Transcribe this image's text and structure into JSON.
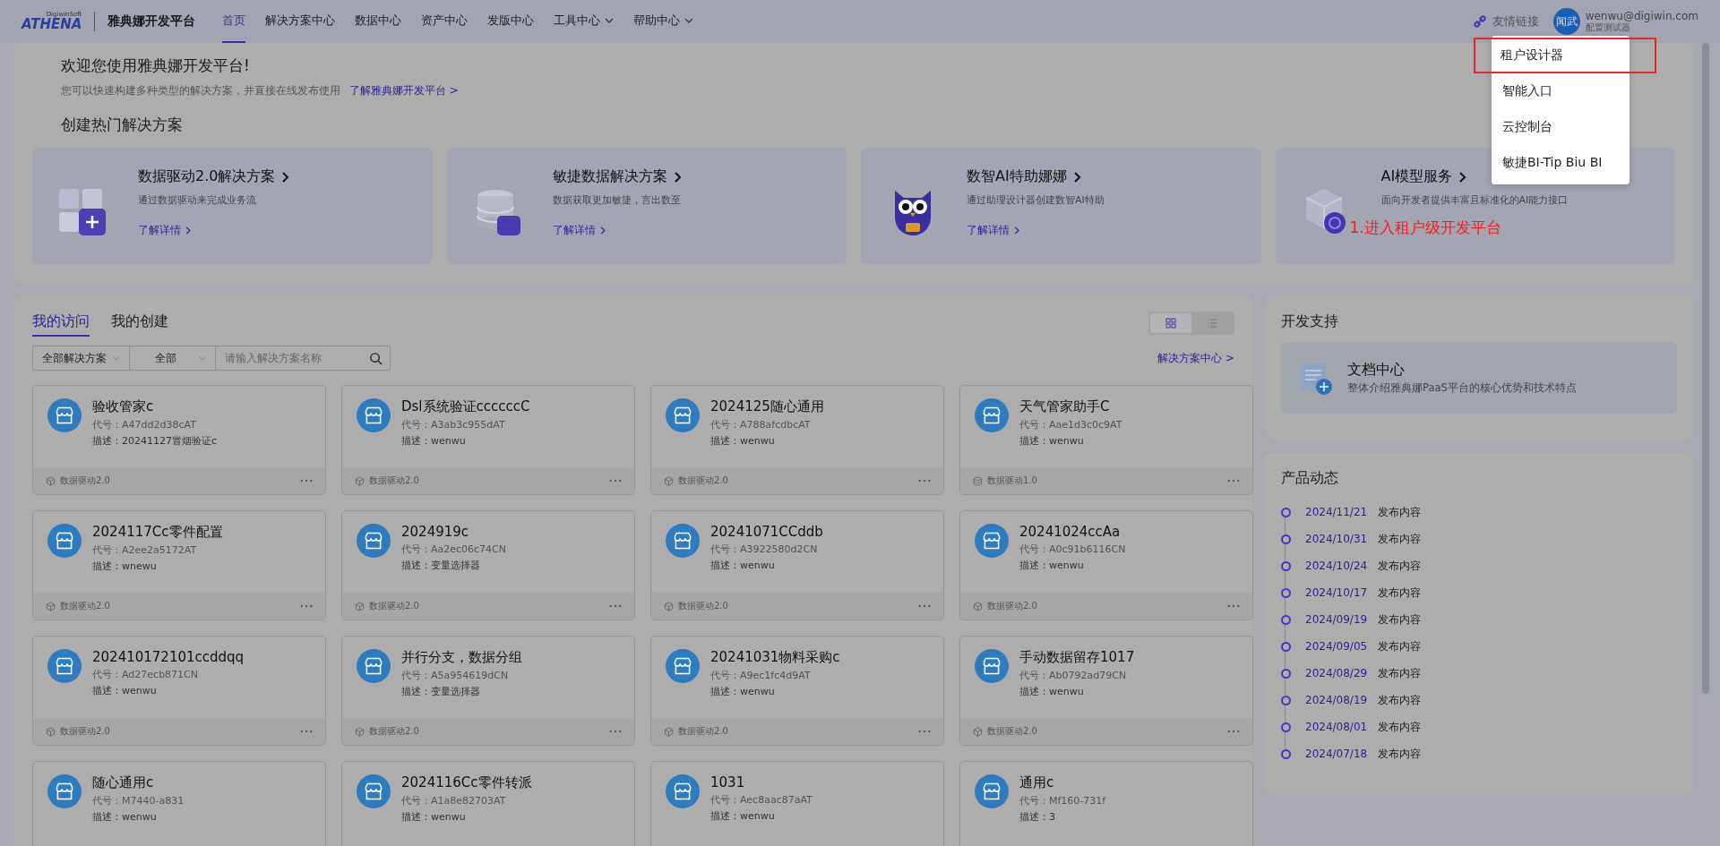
{
  "header": {
    "logo": {
      "brand": "ATHENA",
      "maker": "DigiwinSoft"
    },
    "product": "雅典娜开发平台",
    "nav": [
      {
        "label": "首页",
        "selected": true,
        "has_menu": false
      },
      {
        "label": "解决方案中心",
        "selected": false,
        "has_menu": false
      },
      {
        "label": "数据中心",
        "selected": false,
        "has_menu": false
      },
      {
        "label": "资产中心",
        "selected": false,
        "has_menu": false
      },
      {
        "label": "发版中心",
        "selected": false,
        "has_menu": false
      },
      {
        "label": "工具中心",
        "selected": false,
        "has_menu": true
      },
      {
        "label": "帮助中心",
        "selected": false,
        "has_menu": true
      }
    ],
    "friend_link": "友情链接",
    "user": {
      "avatar": "闻武",
      "email": "wenwu@digiwin.com",
      "role": "配置测试器"
    }
  },
  "dropdown": [
    {
      "label": "租户设计器",
      "highlighted": true
    },
    {
      "label": "智能入口",
      "highlighted": false
    },
    {
      "label": "云控制台",
      "highlighted": false
    },
    {
      "label": "敏捷BI-Tip Biu BI",
      "highlighted": false
    }
  ],
  "welcome": {
    "title": "欢迎您使用雅典娜开发平台!",
    "subtitle": "您可以快速构建多种类型的解决方案，并直接在线发布使用",
    "link": "了解雅典娜开发平台 >",
    "section_title": "创建热门解决方案"
  },
  "hot_solutions": [
    {
      "kind": "blocks",
      "title": "数据驱动2.0解决方案",
      "desc": "通过数据驱动来完成业务流",
      "link": "了解详情"
    },
    {
      "kind": "database",
      "title": "敏捷数据解决方案",
      "desc": "数据获取更加敏捷，言出数至",
      "link": "了解详情"
    },
    {
      "kind": "owl",
      "title": "数智AI特助娜娜",
      "desc": "通过助理设计器创建数智AI特助",
      "link": "了解详情"
    },
    {
      "kind": "cube",
      "title": "AI模型服务",
      "desc": "面向开发者提供丰富且标准化的AI能力接口"
    }
  ],
  "annotation": "1.进入租户级开发平台",
  "solutions": {
    "tabs": [
      {
        "label": "我的访问",
        "selected": true
      },
      {
        "label": "我的创建",
        "selected": false
      }
    ],
    "view_modes": [
      {
        "kind": "grid",
        "selected": true
      },
      {
        "kind": "list",
        "selected": false
      }
    ],
    "filters": {
      "category": "全部解决方案",
      "scope": "全部",
      "search_placeholder": "请输入解决方案名称"
    },
    "center_link": "解决方案中心 >",
    "cards": [
      {
        "title": "验收管家c",
        "code": "代号：A47dd2d38cAT",
        "desc": "描述：20241127冒烟验证c",
        "type": "数据驱动2.0",
        "kind": "cube"
      },
      {
        "title": "Dsl系统验证ccccccC",
        "code": "代号：A3ab3c955dAT",
        "desc": "描述：wenwu",
        "type": "数据驱动2.0",
        "kind": "cube"
      },
      {
        "title": "2024125随心通用",
        "code": "代号：A788afcdbcAT",
        "desc": "描述：wenwu",
        "type": "数据驱动2.0",
        "kind": "cube"
      },
      {
        "title": "天气管家助手C",
        "code": "代号：Aae1d3c0c9AT",
        "desc": "描述：wenwu",
        "type": "数据驱动1.0",
        "kind": "database"
      },
      {
        "title": "2024117Cc零件配置",
        "code": "代号：A2ee2a5172AT",
        "desc": "描述：wnewu",
        "type": "数据驱动2.0",
        "kind": "cube"
      },
      {
        "title": "2024919c",
        "code": "代号：Aa2ec06c74CN",
        "desc": "描述：变量选择器",
        "type": "数据驱动2.0",
        "kind": "cube"
      },
      {
        "title": "20241071CCddb",
        "code": "代号：A3922580d2CN",
        "desc": "描述：wenwu",
        "type": "数据驱动2.0",
        "kind": "cube"
      },
      {
        "title": "20241024ccAa",
        "code": "代号：A0c91b6116CN",
        "desc": "描述：wenwu",
        "type": "数据驱动2.0",
        "kind": "cube"
      },
      {
        "title": "202410172101ccddqq",
        "code": "代号：Ad27ecb871CN",
        "desc": "描述：wenwu",
        "type": "数据驱动2.0",
        "kind": "cube"
      },
      {
        "title": "并行分支，数据分组",
        "code": "代号：A5a954619dCN",
        "desc": "描述：变量选择器",
        "type": "数据驱动2.0",
        "kind": "cube"
      },
      {
        "title": "20241031物料采购c",
        "code": "代号：A9ec1fc4d9AT",
        "desc": "描述：wenwu",
        "type": "数据驱动2.0",
        "kind": "cube"
      },
      {
        "title": "手动数据留存1017",
        "code": "代号：Ab0792ad79CN",
        "desc": "描述：wenwu",
        "type": "数据驱动2.0",
        "kind": "cube"
      },
      {
        "title": "随心通用c",
        "code": "代号：M7440-a831",
        "desc": "描述：wenwu"
      },
      {
        "title": "2024116Cc零件转派",
        "code": "代号：A1a8e82703AT",
        "desc": "描述：wenwu"
      },
      {
        "title": "1031",
        "code": "代号：Aec8aac87aAT",
        "desc": "描述：wenwu"
      },
      {
        "title": "通用c",
        "code": "代号：Mf160-731f",
        "desc": "描述：3"
      }
    ]
  },
  "dev_support": {
    "title": "开发支持",
    "doc": {
      "title": "文档中心",
      "desc": "整体介绍雅典娜PaaS平台的核心优势和技术特点"
    }
  },
  "news": {
    "title": "产品动态",
    "items": [
      {
        "date": "2024/11/21",
        "text": "发布内容"
      },
      {
        "date": "2024/10/31",
        "text": "发布内容"
      },
      {
        "date": "2024/10/24",
        "text": "发布内容"
      },
      {
        "date": "2024/10/17",
        "text": "发布内容"
      },
      {
        "date": "2024/09/19",
        "text": "发布内容"
      },
      {
        "date": "2024/09/05",
        "text": "发布内容"
      },
      {
        "date": "2024/08/29",
        "text": "发布内容"
      },
      {
        "date": "2024/08/19",
        "text": "发布内容"
      },
      {
        "date": "2024/08/01",
        "text": "发布内容"
      },
      {
        "date": "2024/07/18",
        "text": "发布内容"
      }
    ]
  }
}
